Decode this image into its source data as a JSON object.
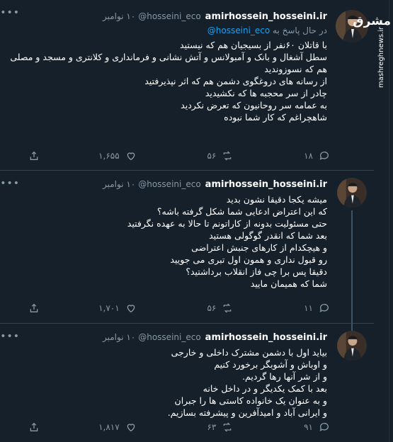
{
  "watermark": {
    "logo": "مشرق",
    "url": "mashreghnews.ir"
  },
  "tweets": [
    {
      "name": "amirhossein_hosseini.ir",
      "handle": "@hosseini_eco",
      "date": "۱۰ نوامبر",
      "reply_prefix": "در حال پاسخ به",
      "reply_handle": "@hosseini_eco",
      "lines": [
        "با قاتلان ۶۰نفر از بسیجیان هم که نیستید",
        "سطل آشغال و بانک و آمبولانس و آتش نشانی و فرمانداری و کلانتری و مسجد و مصلی",
        "هم که نسوزوندید",
        "از رسانه های دروغگوی دشمن هم که اثر نپذیرفتید",
        "چادر از سر محجبه ها که نکشیدید",
        "به عمامه سر روحانیون که تعرض نکردید",
        "شاهچراغم که کار شما نبوده"
      ],
      "reply_count": "۱۸",
      "retweet_count": "۵۶",
      "like_count": "۱,۶۵۵"
    },
    {
      "name": "amirhossein_hosseini.ir",
      "handle": "@hosseini_eco",
      "date": "۱۰ نوامبر",
      "lines": [
        "میشه یکجا دقیقا نشون بدید",
        "که این اعتراض ادعایی شما شکل گرفته باشه؟",
        "حتی مسئولیت بدونه از کاراتونم تا حالا به عهده نگرفتید",
        "بعد شما که انقدر گوگولی هستید",
        "و هیچکدام از کارهای جنبش اعتراضی",
        "رو قبول نداری و همون اول تبری می جویید",
        "دقیقا پس برا چی فاز انقلاب برداشتید؟",
        "شما که همیمان مایید"
      ],
      "reply_count": "۱۱",
      "retweet_count": "۵۶",
      "like_count": "۱,۷۰۱"
    },
    {
      "name": "amirhossein_hosseini.ir",
      "handle": "@hosseini_eco",
      "date": "۱۰ نوامبر",
      "lines": [
        "بیاید اول با دشمن مشترک داخلی و خارجی",
        "و اوباش و آشوبگر برخورد کنیم",
        "و از شر آنها رها گردیم.",
        "بعد با کمک یکدیگر و در داخل خانه",
        "و به عنوان یک خانواده کاستی ها را جبران",
        "و ایرانی آباد و امیدآفرین و پیشرفته بسازیم."
      ],
      "reply_count": "۹۱",
      "retweet_count": "۶۳",
      "like_count": "۱,۸۱۷"
    }
  ]
}
